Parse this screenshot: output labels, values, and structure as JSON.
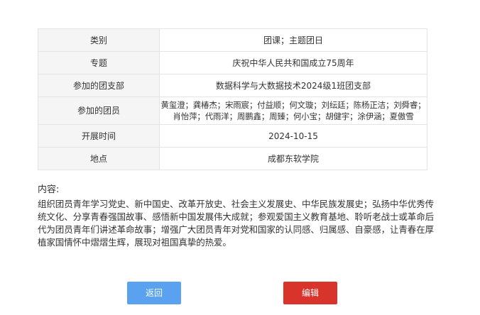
{
  "details": {
    "rows": [
      {
        "label": "类别",
        "value": "团课；主题团日"
      },
      {
        "label": "专题",
        "value": "庆祝中华人民共和国成立75周年"
      },
      {
        "label": "参加的团支部",
        "value": "数据科学与大数据技术2024级1班团支部"
      },
      {
        "label": "参加的团员",
        "value": "黄玺澄；龚椿杰；宋雨宸；付益顺；何文璇；刘纭廷；陈杨正洁；刘舜睿；肖怡萍；代雨洋；周鹏鑫；周臻；何小宝；胡健宇；涂伊涵；夏傲雪"
      },
      {
        "label": "开展时间",
        "value": "2024-10-15"
      },
      {
        "label": "地点",
        "value": "成都东软学院"
      }
    ]
  },
  "content": {
    "title": "内容:",
    "body": "组织团员青年学习党史、新中国史、改革开放史、社会主义发展史、中华民族发展史；弘扬中华优秀传统文化、分享青春强国故事、感悟新中国发展伟大成就；参观爱国主义教育基地、聆听老战士或革命后代为团员青年们讲述革命故事；增强广大团员青年对党和国家的认同感、归属感、自豪感，让青春在厚植家国情怀中熠熠生辉，展现对祖国真挚的热爱。"
  },
  "actions": {
    "back_label": "返回",
    "edit_label": "编辑"
  },
  "colors": {
    "back_button": "#5aa2f0",
    "edit_button": "#d9342b",
    "label_bg": "#f5f5f5",
    "border": "#e4e4e4"
  }
}
